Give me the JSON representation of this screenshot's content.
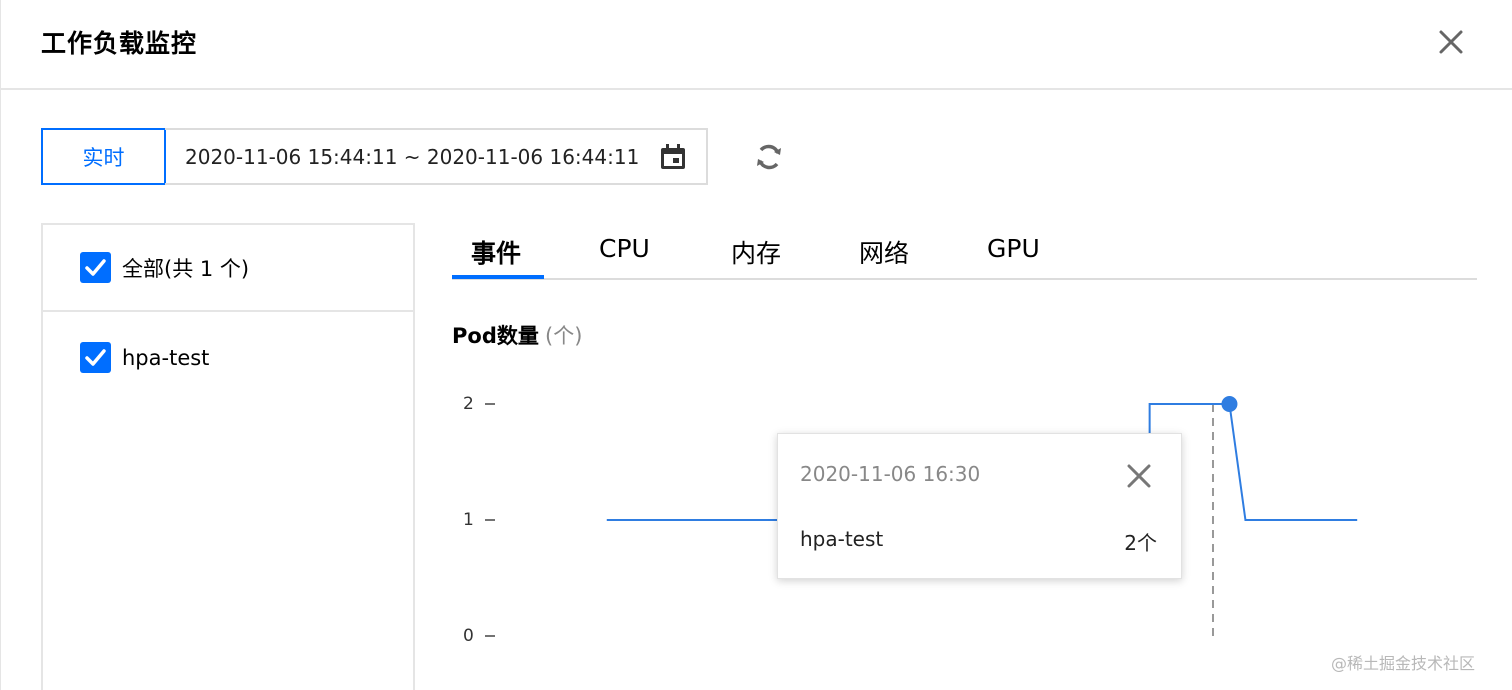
{
  "dialog": {
    "title": "工作负载监控"
  },
  "toolbar": {
    "realtime_label": "实时",
    "date_range": "2020-11-06 15:44:11 ~ 2020-11-06 16:44:11"
  },
  "filter": {
    "all_label": "全部(共 1 个)",
    "items": [
      {
        "label": "hpa-test",
        "checked": true
      }
    ]
  },
  "tabs": [
    {
      "label": "事件",
      "active": true
    },
    {
      "label": "CPU"
    },
    {
      "label": "内存"
    },
    {
      "label": "网络"
    },
    {
      "label": "GPU"
    }
  ],
  "chart_title": "Pod数量",
  "chart_unit": "(个)",
  "chart_data": {
    "type": "line",
    "title": "Pod数量",
    "ylabel": "(个)",
    "ylim": [
      0,
      2
    ],
    "yticks": [
      "0",
      "1",
      "2"
    ],
    "grid": false,
    "series": [
      {
        "name": "hpa-test",
        "color": "#2f7de1",
        "points": [
          {
            "x": "15:51",
            "y": 1
          },
          {
            "x": "16:25",
            "y": 1
          },
          {
            "x": "16:25",
            "y": 2
          },
          {
            "x": "16:30",
            "y": 2
          },
          {
            "x": "16:31",
            "y": 1
          },
          {
            "x": "16:38",
            "y": 1
          }
        ]
      }
    ],
    "highlight": {
      "x": "16:30",
      "y": 2
    }
  },
  "tooltip": {
    "date": "2020-11-06 16:30",
    "series_name": "hpa-test",
    "value": "2个"
  },
  "watermark": "@稀土掘金技术社区",
  "colors": {
    "accent": "#006eff",
    "line": "#2f7de1"
  }
}
